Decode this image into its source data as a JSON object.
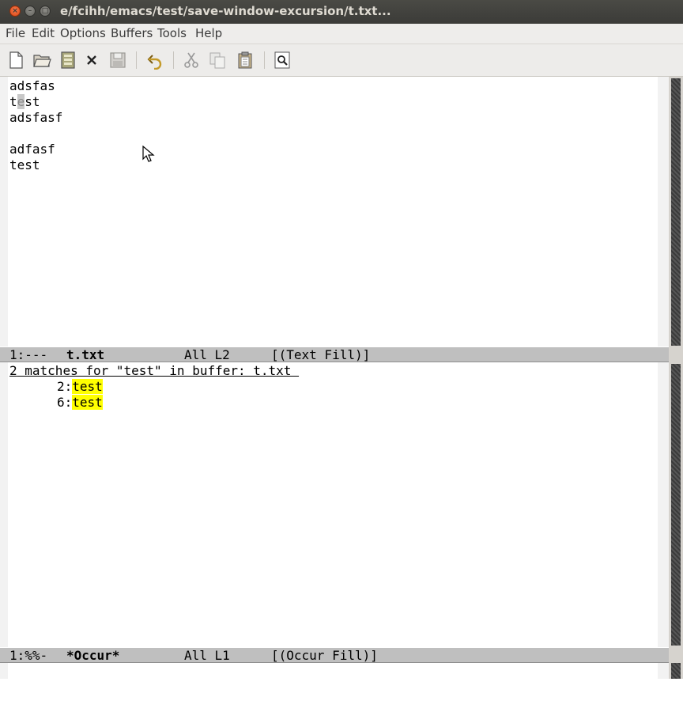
{
  "window": {
    "title": "e/fcihh/emacs/test/save-window-excursion/t.txt...",
    "close_glyph": "×",
    "minimize_glyph": "–",
    "maximize_glyph": "□"
  },
  "menu": [
    "File",
    "Edit",
    "Options",
    "Buffers",
    "Tools",
    "Help"
  ],
  "toolbar_icons": [
    "new-file-icon",
    "open-folder-icon",
    "open-directory-icon",
    "close-buffer-icon",
    "save-icon",
    "undo-icon",
    "cut-icon",
    "copy-icon",
    "paste-icon",
    "search-icon"
  ],
  "top_buffer": {
    "lines": [
      "adsfas",
      "test",
      "adsfasf",
      "",
      "adfasf",
      "test"
    ],
    "line2_before": "t",
    "line2_cursor": "e",
    "line2_after": "st"
  },
  "top_modeline": {
    "status": "1:---",
    "buffer": "t.txt",
    "position": "All L2",
    "mode": "[(Text Fill)]"
  },
  "occur_buffer": {
    "header_count": "2",
    "header_rest": " matches for \"test\" in buffer: t.txt ",
    "matches": [
      {
        "line_no": "2:",
        "text": "test"
      },
      {
        "line_no": "6:",
        "text": "test"
      }
    ]
  },
  "bottom_modeline": {
    "status": "1:%%-",
    "buffer": "*Occur*",
    "position": "All L1",
    "mode": "[(Occur Fill)]"
  },
  "colors": {
    "match_highlight": "#ffff00",
    "close_button": "#dd4814",
    "modeline_bg": "#bfbfbf"
  }
}
